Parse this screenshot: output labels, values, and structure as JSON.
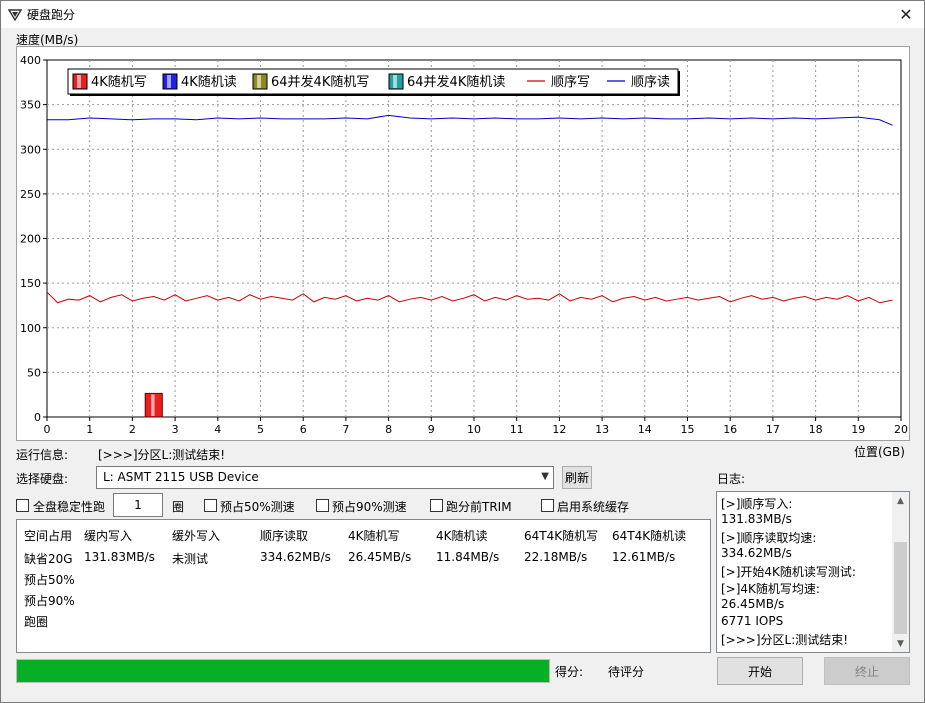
{
  "window": {
    "title": "硬盘跑分"
  },
  "chart": {
    "ylabel": "速度(MB/s)",
    "xlabel": "位置(GB)"
  },
  "chart_data": {
    "type": "line",
    "xlim": [
      0,
      20
    ],
    "ylim": [
      0,
      400
    ],
    "x_ticks": [
      "0",
      "1",
      "2",
      "3",
      "4",
      "5",
      "6",
      "7",
      "8",
      "9",
      "10",
      "11",
      "12",
      "13",
      "14",
      "15",
      "16",
      "17",
      "18",
      "19",
      "20"
    ],
    "y_ticks": [
      "0",
      "50",
      "100",
      "150",
      "200",
      "250",
      "300",
      "350",
      "400"
    ],
    "grid": true,
    "legend_position": "top-left",
    "legend": [
      "4K随机写",
      "4K随机读",
      "64并发4K随机写",
      "64并发4K随机读",
      "顺序写",
      "顺序读"
    ],
    "series": [
      {
        "name": "顺序读",
        "color": "#0000cc",
        "x": [
          0,
          0.5,
          1,
          1.5,
          2,
          2.5,
          3,
          3.5,
          4,
          4.5,
          5,
          5.5,
          6,
          6.5,
          7,
          7.5,
          8,
          8.5,
          9,
          9.5,
          10,
          10.5,
          11,
          11.5,
          12,
          12.5,
          13,
          13.5,
          14,
          14.5,
          15,
          15.5,
          16,
          16.5,
          17,
          17.5,
          18,
          18.5,
          19,
          19.5,
          19.8
        ],
        "y": [
          333,
          333,
          335,
          334,
          333,
          334,
          334,
          333,
          335,
          334,
          335,
          334,
          334,
          334,
          335,
          334,
          338,
          335,
          334,
          335,
          334,
          335,
          334,
          334,
          335,
          334,
          335,
          334,
          335,
          334,
          334,
          335,
          334,
          335,
          334,
          335,
          334,
          335,
          336,
          333,
          327
        ]
      },
      {
        "name": "顺序写",
        "color": "#cc0000",
        "x": [
          0,
          0.25,
          0.5,
          0.75,
          1,
          1.25,
          1.5,
          1.75,
          2,
          2.25,
          2.5,
          2.75,
          3,
          3.25,
          3.5,
          3.75,
          4,
          4.25,
          4.5,
          4.75,
          5,
          5.25,
          5.5,
          5.75,
          6,
          6.25,
          6.5,
          6.75,
          7,
          7.25,
          7.5,
          7.75,
          8,
          8.25,
          8.5,
          8.75,
          9,
          9.25,
          9.5,
          9.75,
          10,
          10.25,
          10.5,
          10.75,
          11,
          11.25,
          11.5,
          11.75,
          12,
          12.25,
          12.5,
          12.75,
          13,
          13.25,
          13.5,
          13.75,
          14,
          14.25,
          14.5,
          14.75,
          15,
          15.25,
          15.5,
          15.75,
          16,
          16.25,
          16.5,
          16.75,
          17,
          17.25,
          17.5,
          17.75,
          18,
          18.25,
          18.5,
          18.75,
          19,
          19.25,
          19.5,
          19.8
        ],
        "y": [
          140,
          128,
          132,
          131,
          136,
          129,
          134,
          137,
          130,
          133,
          135,
          131,
          137,
          130,
          133,
          136,
          131,
          134,
          130,
          137,
          132,
          135,
          133,
          131,
          138,
          129,
          134,
          132,
          136,
          130,
          133,
          131,
          136,
          129,
          132,
          134,
          131,
          135,
          130,
          133,
          137,
          130,
          134,
          131,
          136,
          132,
          133,
          131,
          138,
          130,
          134,
          132,
          136,
          129,
          133,
          135,
          131,
          134,
          130,
          132,
          134,
          131,
          133,
          135,
          129,
          133,
          136,
          132,
          134,
          130,
          133,
          135,
          131,
          134,
          132,
          136,
          130,
          134,
          128,
          131
        ]
      }
    ],
    "bars": [
      {
        "name": "4K随机写",
        "x_center": 2.5,
        "width": 0.4,
        "value": 26.45,
        "color": "#e82020"
      }
    ]
  },
  "status": {
    "label": "运行信息:",
    "text": "[>>>]分区L:测试结束!"
  },
  "disk": {
    "label": "选择硬盘:",
    "selected": "L: ASMT 2115 USB Device",
    "refresh": "刷新"
  },
  "log_title": "日志:",
  "options": {
    "full_disk": "全盘稳定性跑",
    "loops_value": "1",
    "loops_unit": "圈",
    "pre50": "预占50%测速",
    "pre90": "预占90%测速",
    "trim": "跑分前TRIM",
    "cache": "启用系统缓存"
  },
  "results": {
    "headers": [
      "空间占用",
      "缓内写入",
      "缓外写入",
      "顺序读取",
      "4K随机写",
      "4K随机读",
      "64T4K随机写",
      "64T4K随机读"
    ],
    "row": [
      "缺省20G",
      "131.83MB/s",
      "未测试",
      "334.62MB/s",
      "26.45MB/s",
      "11.84MB/s",
      "22.18MB/s",
      "12.61MB/s"
    ],
    "extra_rows": [
      "预占50%",
      "预占90%",
      "跑圈"
    ]
  },
  "log_lines": [
    "[>]顺序写入:",
    "131.83MB/s",
    "[>]顺序读取均速:",
    "334.62MB/s",
    "[>]开始4K随机读写测试:",
    "[>]4K随机写均速:",
    "26.45MB/s",
    "6771 IOPS",
    "[>>>]分区L:测试结束!"
  ],
  "progress": {
    "fraction": 1.0
  },
  "score": {
    "label": "得分:",
    "value": "待评分"
  },
  "buttons": {
    "start": "开始",
    "stop": "终止"
  }
}
